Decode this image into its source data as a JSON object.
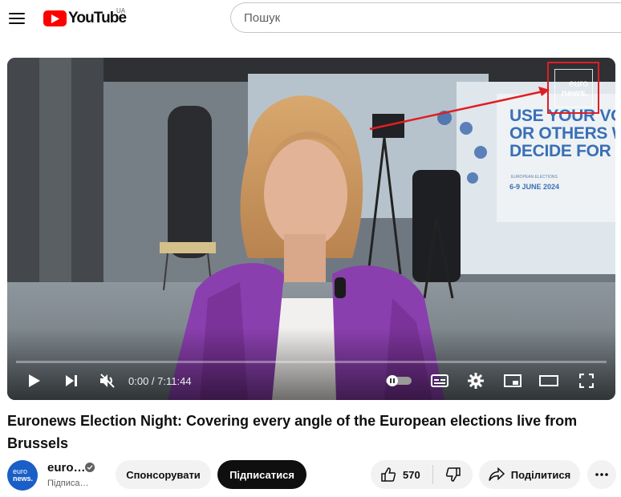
{
  "masthead": {
    "logo_text": "YouTube",
    "region": "UA",
    "search_placeholder": "Пошук"
  },
  "player": {
    "watermark_line1": "euro",
    "watermark_line2": "news.",
    "banner_text": "USE YOUR VO\nOR OTHERS W\nDECIDE FOR Y",
    "banner_small": "EUROPEAN ELECTIONS",
    "banner_date": "6-9 JUNE 2024",
    "time_display": "0:00 / 7:11:44",
    "progress_fraction": 0.0
  },
  "video": {
    "title": "Euronews Election Night: Covering every angle of the European elections live from Brussels"
  },
  "owner": {
    "avatar_line1": "euro",
    "avatar_line2": "news.",
    "channel_name": "euro…",
    "subscribers": "Підписа…",
    "sponsor_label": "Спонсорувати",
    "subscribe_label": "Підписатися"
  },
  "actions": {
    "like_count": "570",
    "share_label": "Поділитися"
  },
  "colors": {
    "brand_red": "#ff0000",
    "annotation_red": "#e11d23",
    "subscribe_bg": "#0f0f0f",
    "pill_bg": "#f2f2f2",
    "euronews_blue": "#1a5ec7"
  },
  "icons": [
    "menu-icon",
    "youtube-logo-icon",
    "play-icon",
    "next-icon",
    "mute-icon",
    "autoplay-toggle-icon",
    "subtitles-icon",
    "settings-icon",
    "miniplayer-icon",
    "theater-icon",
    "fullscreen-icon",
    "verified-icon",
    "like-icon",
    "dislike-icon",
    "share-icon",
    "more-icon"
  ]
}
